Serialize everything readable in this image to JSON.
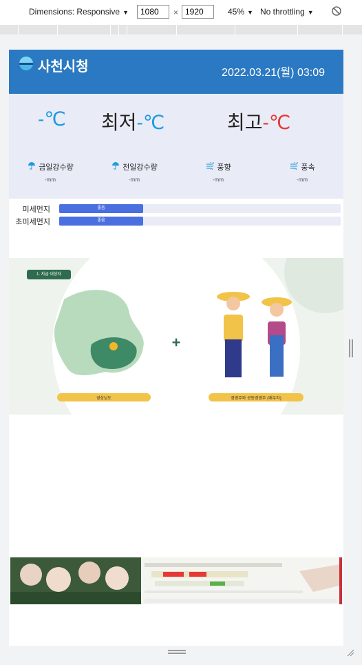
{
  "devtools": {
    "dimensions_label": "Dimensions: Responsive",
    "width_value": "1080",
    "height_value": "1920",
    "times": "×",
    "zoom": "45%",
    "throttling": "No throttling",
    "rotate_icon": "rotate-icon"
  },
  "site": {
    "title": "사천시청",
    "datetime": "2022.03.21(월) 03:09"
  },
  "weather": {
    "current_value": "-",
    "unit": "℃",
    "min_label": "최저",
    "min_value": "-",
    "max_label": "최고",
    "max_value": "-",
    "colors": {
      "blue": "#1e9be0",
      "red": "#e53935"
    },
    "stats": [
      {
        "icon": "umbrella-icon",
        "label": "금일강수량",
        "value": "-mm"
      },
      {
        "icon": "umbrella-icon",
        "label": "전일강수량",
        "value": "-mm"
      },
      {
        "icon": "wind-icon",
        "label": "풍향",
        "value": "-mm"
      },
      {
        "icon": "wind-icon",
        "label": "풍속",
        "value": "-mm"
      }
    ]
  },
  "dust": [
    {
      "label": "미세먼지",
      "status": "좋음"
    },
    {
      "label": "초미세먼지",
      "status": "좋음"
    }
  ],
  "banner1": {
    "tag": "1. 지급 대상자",
    "left_caption": "경상남도",
    "right_caption": "경영주와 공동경영주 (배우자)"
  },
  "accent_color": "#2b79c2"
}
